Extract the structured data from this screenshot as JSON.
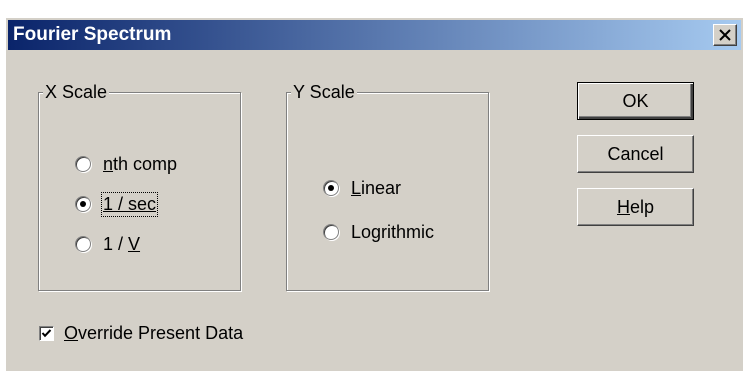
{
  "window": {
    "title": "Fourier Spectrum",
    "close_glyph": "×"
  },
  "x_scale": {
    "legend": "X Scale",
    "options": [
      {
        "label_access": "n",
        "label_rest": "th comp",
        "checked": false
      },
      {
        "label_access": "1 / sec",
        "label_rest": "",
        "checked": true
      },
      {
        "label_pre": "1 / ",
        "label_access": "V",
        "checked": false
      }
    ]
  },
  "y_scale": {
    "legend": "Y Scale",
    "options": [
      {
        "label_access": "L",
        "label_rest": "inear",
        "checked": true
      },
      {
        "label_access": "",
        "label_rest": "Logrithmic",
        "checked": false
      }
    ]
  },
  "buttons": {
    "ok": "OK",
    "cancel": "Cancel",
    "help_access": "H",
    "help_rest": "elp"
  },
  "override": {
    "label_access": "O",
    "label_rest": "verride Present Data",
    "checked": true
  },
  "icons": {
    "close": "close-icon",
    "checkmark": "checkmark-icon"
  },
  "colors": {
    "titlebar_start": "#0a246a",
    "titlebar_end": "#a6caf0",
    "face": "#d4d0c8"
  }
}
